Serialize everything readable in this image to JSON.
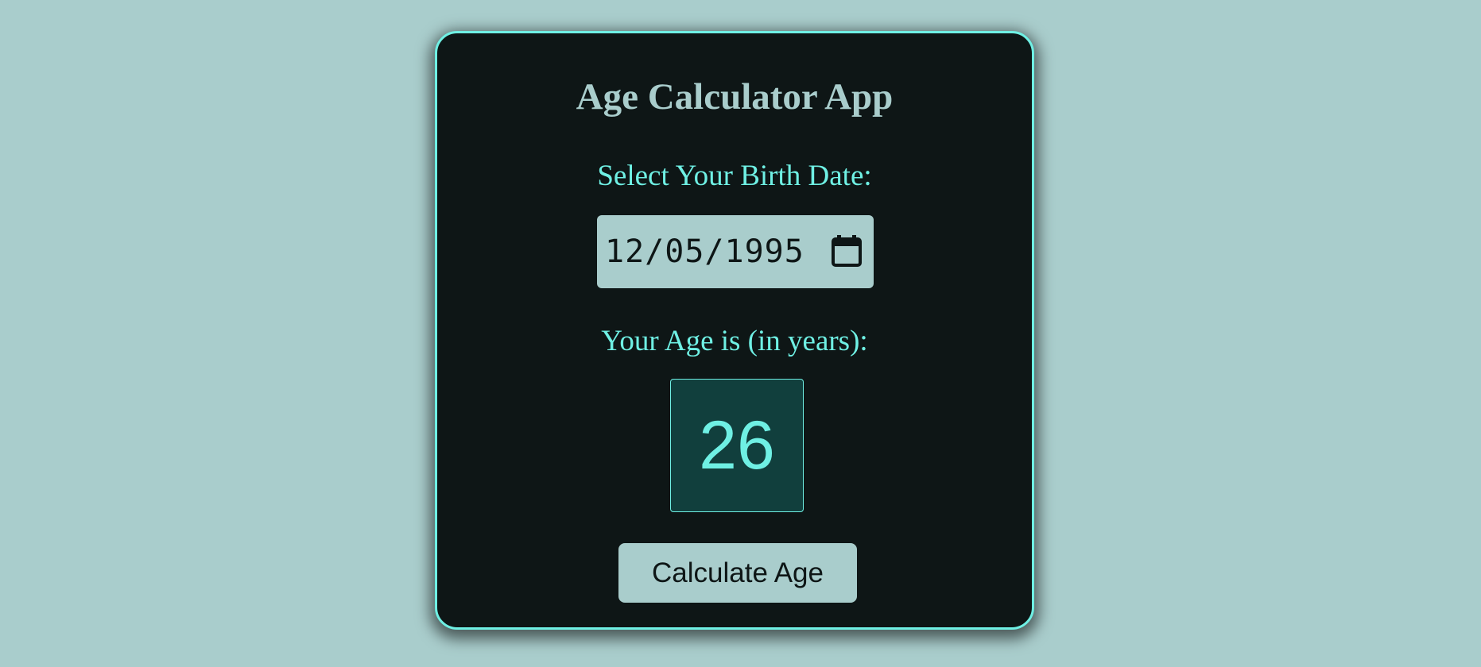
{
  "app": {
    "title": "Age Calculator App"
  },
  "birth_date": {
    "label": "Select Your Birth Date:",
    "value": "12/05/1995",
    "icon": "calendar-icon"
  },
  "age": {
    "label": "Your Age is (in years):",
    "value": "26"
  },
  "actions": {
    "calculate_label": "Calculate Age"
  },
  "colors": {
    "background": "#a9cdcc",
    "card": "#0e1616",
    "accent": "#6ff0e4",
    "age_box": "#113f3d"
  }
}
